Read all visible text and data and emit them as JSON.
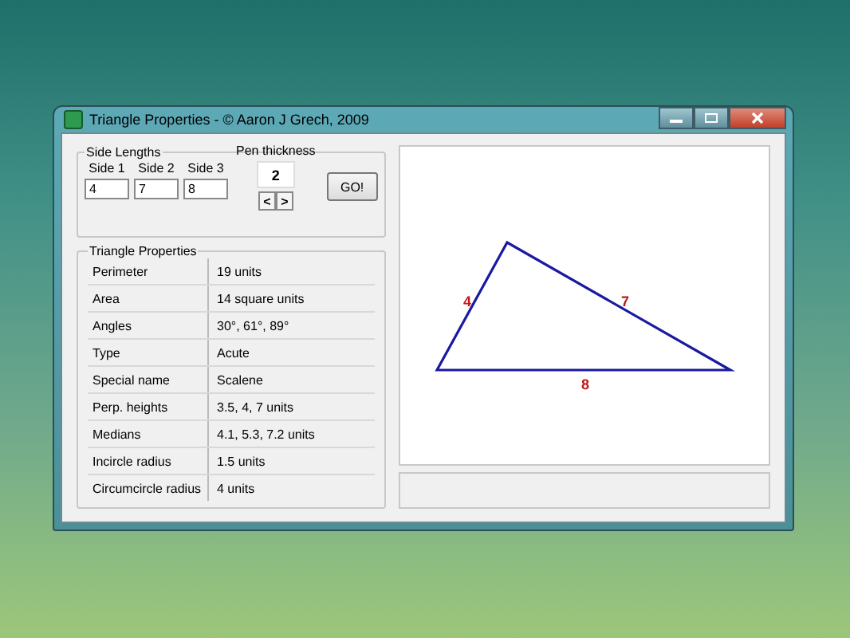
{
  "window": {
    "title": "Triangle Properties - © Aaron J Grech, 2009"
  },
  "side_lengths": {
    "title": "Side Lengths",
    "sides": [
      {
        "label": "Side 1",
        "value": "4"
      },
      {
        "label": "Side 2",
        "value": "7"
      },
      {
        "label": "Side 3",
        "value": "8"
      }
    ],
    "pen_label": "Pen thickness",
    "pen_value": "2",
    "decrease": "<",
    "increase": ">",
    "go": "GO!"
  },
  "properties": {
    "title": "Triangle Properties",
    "rows": [
      {
        "name": "Perimeter",
        "value": "19 units"
      },
      {
        "name": "Area",
        "value": "14 square units"
      },
      {
        "name": "Angles",
        "value": "30°, 61°, 89°"
      },
      {
        "name": "Type",
        "value": "Acute"
      },
      {
        "name": "Special name",
        "value": "Scalene"
      },
      {
        "name": "Perp. heights",
        "value": "3.5, 4, 7 units"
      },
      {
        "name": "Medians",
        "value": "4.1, 5.3, 7.2 units"
      },
      {
        "name": "Incircle radius",
        "value": "1.5 units"
      },
      {
        "name": "Circumcircle radius",
        "value": "4 units"
      }
    ]
  },
  "drawing": {
    "side_labels": [
      "4",
      "7",
      "8"
    ]
  }
}
